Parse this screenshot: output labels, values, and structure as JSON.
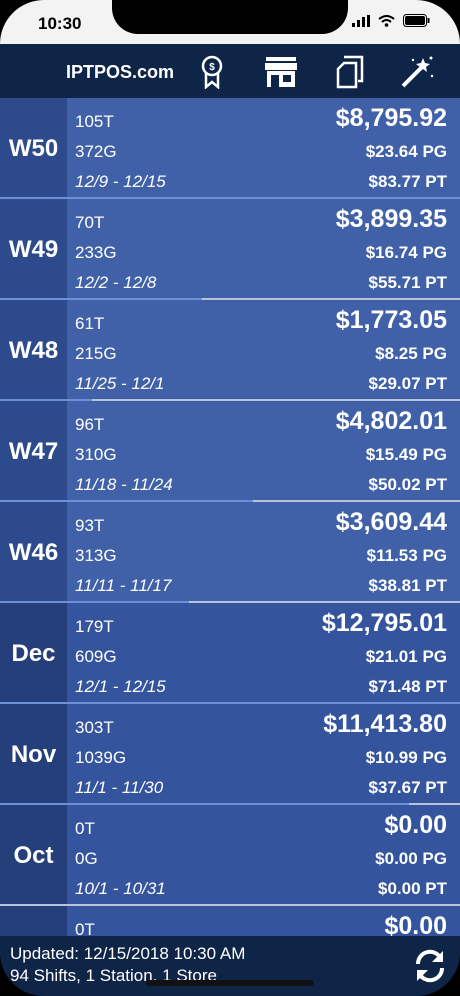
{
  "status": {
    "time": "10:30"
  },
  "navbar": {
    "title": "IPTPOS.com",
    "icons": [
      "ribbon-icon",
      "store-icon",
      "copy-icon",
      "magic-wand-icon"
    ]
  },
  "rows": [
    {
      "label": "W50",
      "tickets": "105T",
      "gallons": "372G",
      "dates": "12/9 - 12/15",
      "total": "$8,795.92",
      "pg": "$23.64 PG",
      "pt": "$83.77 PT",
      "progress": 1.0
    },
    {
      "label": "W49",
      "tickets": "70T",
      "gallons": "233G",
      "dates": "12/2 - 12/8",
      "total": "$3,899.35",
      "pg": "$16.74 PG",
      "pt": "$55.71 PT",
      "progress": 0.44
    },
    {
      "label": "W48",
      "tickets": "61T",
      "gallons": "215G",
      "dates": "11/25 - 12/1",
      "total": "$1,773.05",
      "pg": "$8.25 PG",
      "pt": "$29.07 PT",
      "progress": 0.2
    },
    {
      "label": "W47",
      "tickets": "96T",
      "gallons": "310G",
      "dates": "11/18 - 11/24",
      "total": "$4,802.01",
      "pg": "$15.49 PG",
      "pt": "$50.02 PT",
      "progress": 0.55
    },
    {
      "label": "W46",
      "tickets": "93T",
      "gallons": "313G",
      "dates": "11/11 - 11/17",
      "total": "$3,609.44",
      "pg": "$11.53 PG",
      "pt": "$38.81 PT",
      "progress": 0.41
    },
    {
      "label": "Dec",
      "tickets": "179T",
      "gallons": "609G",
      "dates": "12/1 - 12/15",
      "total": "$12,795.01",
      "pg": "$21.01 PG",
      "pt": "$71.48 PT",
      "progress": 1.0,
      "month": true
    },
    {
      "label": "Nov",
      "tickets": "303T",
      "gallons": "1039G",
      "dates": "11/1 - 11/30",
      "total": "$11,413.80",
      "pg": "$10.99 PG",
      "pt": "$37.67 PT",
      "progress": 0.89,
      "month": true
    },
    {
      "label": "Oct",
      "tickets": "0T",
      "gallons": "0G",
      "dates": "10/1 - 10/31",
      "total": "$0.00",
      "pg": "$0.00 PG",
      "pt": "$0.00 PT",
      "progress": 0.0,
      "month": true
    },
    {
      "label": "",
      "tickets": "0T",
      "gallons": "",
      "dates": "",
      "total": "$0.00",
      "pg": "",
      "pt": "",
      "progress": 0.0,
      "month": true
    }
  ],
  "footer": {
    "updated": "Updated: 12/15/2018 10:30 AM",
    "summary": "94 Shifts, 1 Station, 1 Store"
  },
  "colors": {
    "navy": "#0f2548",
    "row": "#4060a8",
    "label": "#2d4b8c",
    "accent": "#6d8fd6"
  }
}
